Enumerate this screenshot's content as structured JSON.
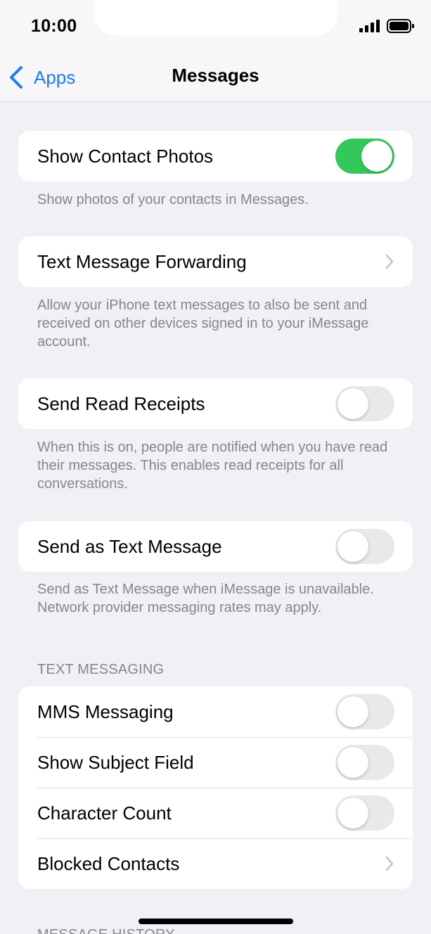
{
  "status_bar": {
    "time": "10:00"
  },
  "nav": {
    "back_label": "Apps",
    "title": "Messages"
  },
  "groups": {
    "contact_photos": {
      "label": "Show Contact Photos",
      "toggle_on": true,
      "footer": "Show photos of your contacts in Messages."
    },
    "forwarding": {
      "label": "Text Message Forwarding",
      "footer": "Allow your iPhone text messages to also be sent and received on other devices signed in to your iMessage account."
    },
    "read_receipts": {
      "label": "Send Read Receipts",
      "toggle_on": false,
      "footer": "When this is on, people are notified when you have read their messages. This enables read receipts for all conversations."
    },
    "send_as_sms": {
      "label": "Send as Text Message",
      "toggle_on": false,
      "footer": "Send as Text Message when iMessage is unavailable. Network provider messaging rates may apply."
    }
  },
  "text_messaging": {
    "header": "TEXT MESSAGING",
    "items": [
      {
        "label": "MMS Messaging",
        "toggle_on": false
      },
      {
        "label": "Show Subject Field",
        "toggle_on": false
      },
      {
        "label": "Character Count",
        "toggle_on": false
      },
      {
        "label": "Blocked Contacts"
      }
    ]
  },
  "message_history": {
    "header": "MESSAGE HISTORY"
  },
  "colors": {
    "accent": "#1a7cf5",
    "toggle_on": "#34c759",
    "toggle_off": "#e9e9eb",
    "background": "#f0f0f5",
    "footer_text": "#86868b"
  }
}
